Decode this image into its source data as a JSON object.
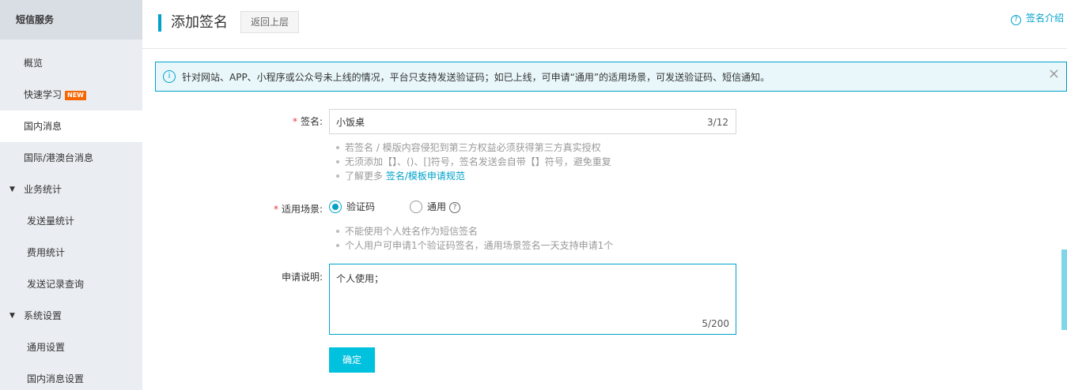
{
  "sidebar": {
    "header": "短信服务",
    "items": [
      {
        "label": "概览"
      },
      {
        "label": "快速学习",
        "badge": "NEW"
      },
      {
        "label": "国内消息"
      },
      {
        "label": "国际/港澳台消息"
      },
      {
        "label": "业务统计"
      },
      {
        "label": "发送量统计"
      },
      {
        "label": "费用统计"
      },
      {
        "label": "发送记录查询"
      },
      {
        "label": "系统设置"
      },
      {
        "label": "通用设置"
      },
      {
        "label": "国内消息设置"
      }
    ]
  },
  "header": {
    "title": "添加签名",
    "back_label": "返回上层",
    "help_label": "签名介绍",
    "help_icon": "?"
  },
  "notice": {
    "info_icon": "i",
    "text": "针对网站、APP、小程序或公众号未上线的情况，平台只支持发送验证码；如已上线，可申请“通用”的适用场景，可发送验证码、短信通知。",
    "close": "×"
  },
  "form": {
    "required_mark": "*",
    "signature": {
      "label": "签名:",
      "value": "小饭桌",
      "counter": "3/12",
      "hints": [
        "若签名 / 模版内容侵犯到第三方权益必须获得第三方真实授权",
        "无须添加【】、()、[]符号，签名发送会自带【】符号，避免重复"
      ],
      "hint_more_prefix": "了解更多 ",
      "hint_more_link": "签名/模板申请规范"
    },
    "scene": {
      "label": "适用场景:",
      "options": [
        {
          "label": "验证码",
          "checked": true
        },
        {
          "label": "通用",
          "checked": false
        }
      ],
      "help_icon": "?",
      "hints": [
        "不能使用个人姓名作为短信签名",
        "个人用户可申请1个验证码签名，通用场景签名一天支持申请1个"
      ]
    },
    "description": {
      "label": "申请说明:",
      "value": "个人使用；",
      "counter": "5/200"
    },
    "submit_label": "确定"
  },
  "colors": {
    "accent": "#00a2ca",
    "button": "#00c1de",
    "required": "#e4393c",
    "badge": "#f56600"
  }
}
